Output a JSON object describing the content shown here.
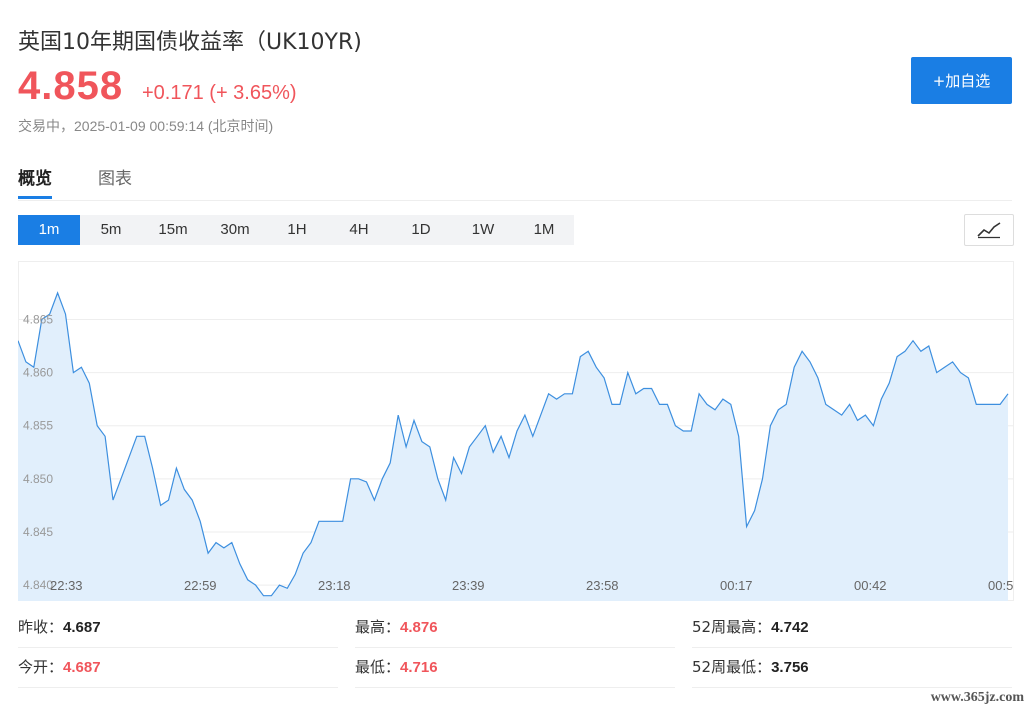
{
  "header": {
    "title": "英国10年期国债收益率（UK10YR)",
    "price": "4.858",
    "change": "+0.171 (+ 3.65%)",
    "status": "交易中，",
    "datetime": "2025-01-09 00:59:14 (北京时间)",
    "add_button_label": "+加自选"
  },
  "tabs": [
    {
      "label": "概览",
      "active": true
    },
    {
      "label": "图表",
      "active": false
    }
  ],
  "periods": [
    "1m",
    "5m",
    "15m",
    "30m",
    "1H",
    "4H",
    "1D",
    "1W",
    "1M"
  ],
  "active_period": "1m",
  "chart_type_icon": "line-chart-icon",
  "colors": {
    "accent": "#1a7ee4",
    "up": "#f0555b",
    "line": "#3d8fdf",
    "area": "#e1effc"
  },
  "chart_data": {
    "type": "area",
    "x_tick_labels": [
      "22:33",
      "22:59",
      "23:18",
      "23:39",
      "23:58",
      "00:17",
      "00:42",
      "00:5"
    ],
    "y_ticks": [
      4.84,
      4.845,
      4.85,
      4.855,
      4.86,
      4.865
    ],
    "y_tick_labels": [
      "4.840",
      "4.845",
      "4.850",
      "4.855",
      "4.860",
      "4.865"
    ],
    "ylim": [
      4.8385,
      4.8705
    ],
    "grid": true,
    "series": [
      {
        "values": [
          4.863,
          4.861,
          4.8605,
          4.865,
          4.8655,
          4.8675,
          4.8655,
          4.86,
          4.8605,
          4.859,
          4.855,
          4.854,
          4.848,
          4.85,
          4.852,
          4.854,
          4.854,
          4.851,
          4.8475,
          4.848,
          4.851,
          4.849,
          4.848,
          4.846,
          4.843,
          4.844,
          4.8435,
          4.844,
          4.842,
          4.8405,
          4.84,
          4.839,
          4.839,
          4.84,
          4.8397,
          4.841,
          4.843,
          4.844,
          4.846,
          4.846,
          4.846,
          4.846,
          4.85,
          4.85,
          4.8497,
          4.848,
          4.85,
          4.8515,
          4.856,
          4.853,
          4.8555,
          4.8535,
          4.853,
          4.85,
          4.848,
          4.852,
          4.8505,
          4.853,
          4.854,
          4.855,
          4.8525,
          4.854,
          4.852,
          4.8545,
          4.856,
          4.854,
          4.856,
          4.858,
          4.8575,
          4.858,
          4.858,
          4.8615,
          4.862,
          4.8605,
          4.8595,
          4.857,
          4.857,
          4.86,
          4.858,
          4.8585,
          4.8585,
          4.857,
          4.857,
          4.855,
          4.8545,
          4.8545,
          4.858,
          4.857,
          4.8565,
          4.8575,
          4.857,
          4.854,
          4.8455,
          4.847,
          4.85,
          4.855,
          4.8565,
          4.857,
          4.8605,
          4.862,
          4.861,
          4.8595,
          4.857,
          4.8565,
          4.856,
          4.857,
          4.8555,
          4.856,
          4.855,
          4.8575,
          4.859,
          4.8615,
          4.862,
          4.863,
          4.862,
          4.8625,
          4.86,
          4.8605,
          4.861,
          4.86,
          4.8595,
          4.857,
          4.857,
          4.857,
          4.857,
          4.858
        ]
      }
    ]
  },
  "stats": [
    [
      {
        "label": "昨收：",
        "value": "4.687",
        "color": "dark"
      },
      {
        "label": "最高：",
        "value": "4.876",
        "color": "red"
      },
      {
        "label": "52周最高：",
        "value": "4.742",
        "color": "dark"
      }
    ],
    [
      {
        "label": "今开：",
        "value": "4.687",
        "color": "red"
      },
      {
        "label": "最低：",
        "value": "4.716",
        "color": "red"
      },
      {
        "label": "52周最低：",
        "value": "3.756",
        "color": "dark"
      }
    ]
  ],
  "watermark": "www.365jz.com"
}
